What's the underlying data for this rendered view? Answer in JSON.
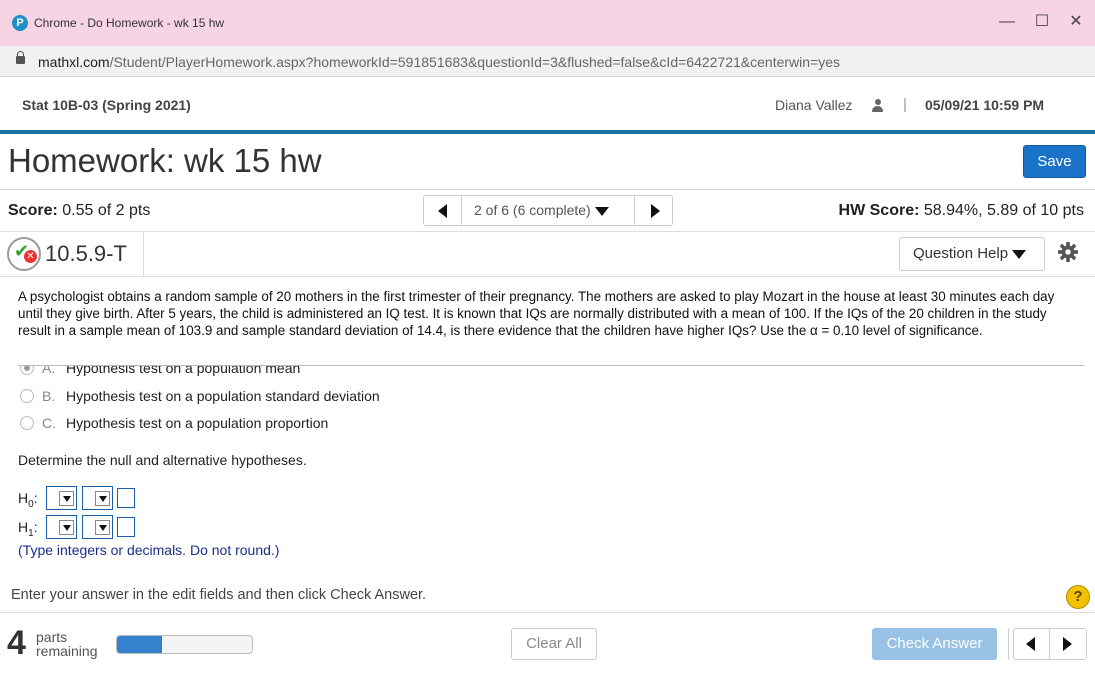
{
  "window": {
    "title": "Chrome - Do Homework - wk 15 hw",
    "logo_letter": "P"
  },
  "address_bar": {
    "host": "mathxl.com",
    "path": "/Student/PlayerHomework.aspx?homeworkId=591851683&questionId=3&flushed=false&cId=6422721&centerwin=yes"
  },
  "course": {
    "name": "Stat 10B-03 (Spring 2021)",
    "user": "Diana Vallez",
    "separator": "|",
    "datetime": "05/09/21 10:59 PM"
  },
  "homework": {
    "title": "Homework: wk 15 hw",
    "save_label": "Save",
    "score_label": "Score:",
    "score_value": "0.55 of 2 pts",
    "position": "2 of 6 (6 complete)",
    "hw_score_label": "HW Score:",
    "hw_score_value": "58.94%, 5.89 of 10 pts"
  },
  "question": {
    "id": "10.5.9-T",
    "help_label": "Question Help",
    "text": "A psychologist obtains a random sample of 20 mothers in the first trimester of their pregnancy. The mothers are asked to play Mozart in the house at least 30 minutes each day until they give birth. After 5 years, the child is administered an IQ test. It is known that IQs are normally distributed with a mean of 100. If the IQs of the 20 children in the study result in a sample mean of 103.9 and sample standard deviation of 14.4, is there evidence that the children have higher IQs? Use the α = 0.10 level of significance.",
    "options": [
      {
        "letter": "A.",
        "text": "Hypothesis test on a population mean",
        "selected": true
      },
      {
        "letter": "B.",
        "text": "Hypothesis test on a population standard deviation",
        "selected": false
      },
      {
        "letter": "C.",
        "text": "Hypothesis test on a population proportion",
        "selected": false
      }
    ],
    "determine": "Determine the null and alternative hypotheses.",
    "h0_label": "H",
    "h0_sub": "0",
    "h1_label": "H",
    "h1_sub": "1",
    "colon": ":",
    "hint": "(Type integers or decimals. Do not round.)"
  },
  "footer": {
    "instruction": "Enter your answer in the edit fields and then click Check Answer.",
    "help_icon": "?",
    "parts_count": "4",
    "parts_label_1": "parts",
    "parts_label_2": "remaining",
    "progress_fraction": 0.33,
    "clear_label": "Clear All",
    "check_label": "Check Answer"
  },
  "colors": {
    "titlebar": "#f7d4e3",
    "accent": "#19739c",
    "save_button": "#1b73c9",
    "check_button": "#98c1e4",
    "progress_fill": "#3481cd"
  }
}
